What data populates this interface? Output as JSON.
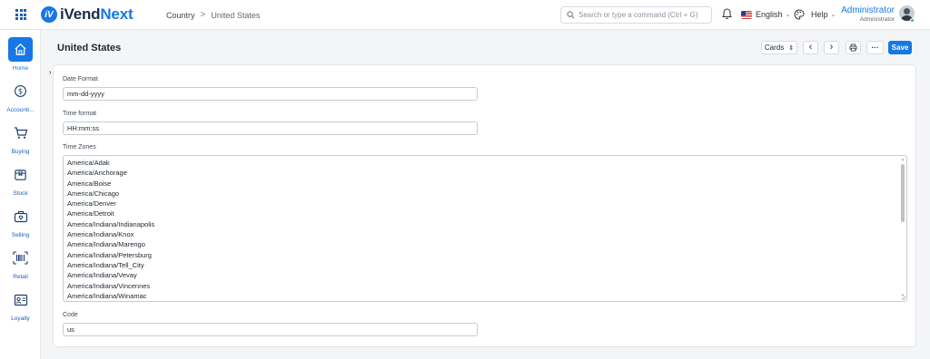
{
  "app": {
    "logo_mark": "iV",
    "name_prefix": "iVend",
    "name_suffix": "Next"
  },
  "breadcrumb": {
    "parent": "Country",
    "separator": ">",
    "current": "United States"
  },
  "search": {
    "placeholder": "Search or type a command (Ctrl + G)",
    "value": ""
  },
  "language": {
    "label": "English",
    "caret": "⌄"
  },
  "help": {
    "label": "Help",
    "caret": "⌄"
  },
  "user": {
    "name": "Administrator",
    "role": "Administrator"
  },
  "sidebar": {
    "items": [
      {
        "label": "Home",
        "icon": "home-icon",
        "active": true
      },
      {
        "label": "Accounti...",
        "icon": "dollar-icon"
      },
      {
        "label": "Buying",
        "icon": "cart-icon"
      },
      {
        "label": "Stock",
        "icon": "box-icon"
      },
      {
        "label": "Selling",
        "icon": "selling-icon"
      },
      {
        "label": "Retail",
        "icon": "barcode-icon"
      },
      {
        "label": "Loyalty",
        "icon": "card-icon"
      }
    ]
  },
  "page": {
    "title": "United States"
  },
  "toolbar": {
    "cards_label": "Cards",
    "cards_caret": "⇕",
    "prev": "‹",
    "next": "›",
    "more": "···",
    "save_label": "Save"
  },
  "form": {
    "date_format": {
      "label": "Date Format",
      "value": "mm-dd-yyyy"
    },
    "time_format": {
      "label": "Time format",
      "value": "HH:mm:ss"
    },
    "time_zones": {
      "label": "Time Zones",
      "options": [
        "America/Adak",
        "America/Anchorage",
        "America/Boise",
        "America/Chicago",
        "America/Denver",
        "America/Detroit",
        "America/Indiana/Indianapolis",
        "America/Indiana/Knox",
        "America/Indiana/Marengo",
        "America/Indiana/Petersburg",
        "America/Indiana/Tell_City",
        "America/Indiana/Vevay",
        "America/Indiana/Vincennes",
        "America/Indiana/Winamac"
      ]
    },
    "code": {
      "label": "Code",
      "value": "us"
    }
  },
  "colors": {
    "primary": "#1877e6",
    "brand_dark": "#1a2d48",
    "online": "#34c759"
  }
}
